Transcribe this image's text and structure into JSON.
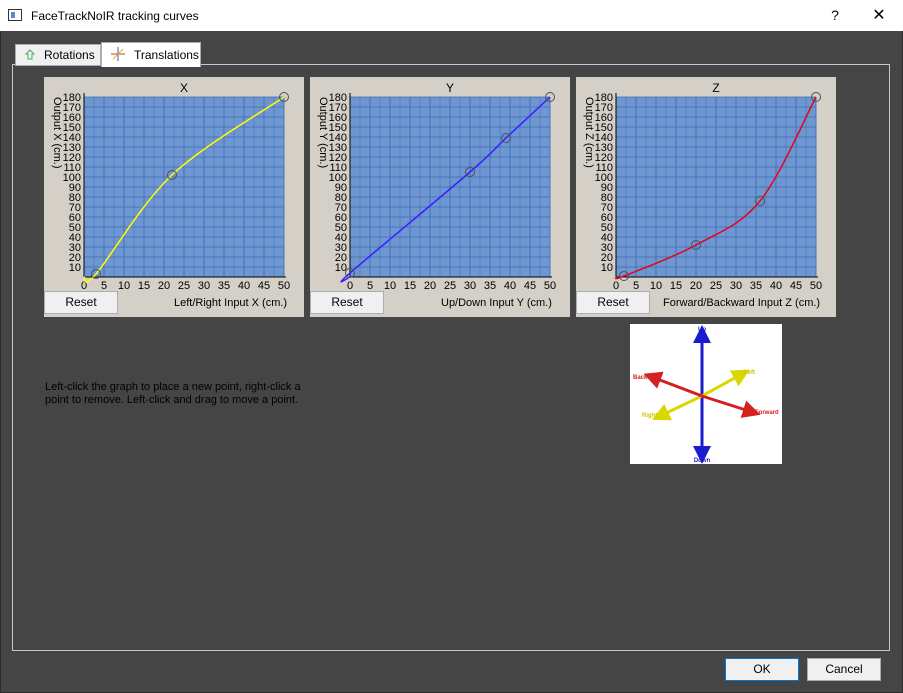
{
  "window": {
    "title": "FaceTrackNoIR tracking curves",
    "help_label": "?",
    "close_label": "✕"
  },
  "tabs": [
    {
      "label": "Rotations",
      "icon": "rotation-icon",
      "active": false
    },
    {
      "label": "Translations",
      "icon": "translation-icon",
      "active": true
    }
  ],
  "graphs": [
    {
      "axis": "X",
      "title": "X",
      "ylabel": "Output X (cm.)",
      "xlabel": "Left/Right Input X (cm.)",
      "reset_label": "Reset",
      "color": "#ffff00",
      "points": [
        [
          3,
          3
        ],
        [
          22,
          102
        ],
        [
          50,
          180
        ]
      ]
    },
    {
      "axis": "Y",
      "title": "Y",
      "ylabel": "Output Y (cm.)",
      "xlabel": "Up/Down Input Y (cm.)",
      "reset_label": "Reset",
      "color": "#3b1eff",
      "points": [
        [
          0,
          4
        ],
        [
          30,
          105
        ],
        [
          39,
          139
        ],
        [
          50,
          180
        ]
      ]
    },
    {
      "axis": "Z",
      "title": "Z",
      "ylabel": "Output Z (cm.)",
      "xlabel": "Forward/Backward Input Z (cm.)",
      "reset_label": "Reset",
      "color": "#e8001c",
      "points": [
        [
          2,
          1
        ],
        [
          20,
          32
        ],
        [
          36,
          76
        ],
        [
          50,
          180
        ]
      ]
    }
  ],
  "graph_axes": {
    "x_ticks": [
      "0",
      "5",
      "10",
      "15",
      "20",
      "25",
      "30",
      "35",
      "40",
      "45",
      "50"
    ],
    "y_ticks": [
      "10",
      "20",
      "30",
      "40",
      "50",
      "60",
      "70",
      "80",
      "90",
      "100",
      "110",
      "120",
      "130",
      "140",
      "150",
      "160",
      "170",
      "180"
    ],
    "xlim": [
      0,
      50
    ],
    "ylim": [
      0,
      180
    ],
    "grid": true,
    "plot_bg": "#6e97d2",
    "grid_color": "#3f6db5"
  },
  "help_text": "Left-click the graph to place a new point, right-click a point to remove. Left-click and drag to move a point.",
  "axis_diagram": {
    "labels": [
      "Up",
      "Down",
      "Left",
      "Right",
      "Back",
      "Forward"
    ],
    "colors": {
      "updown": "#1b1bd0",
      "leftright": "#d8d800",
      "backforward": "#d42020"
    }
  },
  "buttons": {
    "ok": "OK",
    "cancel": "Cancel"
  }
}
